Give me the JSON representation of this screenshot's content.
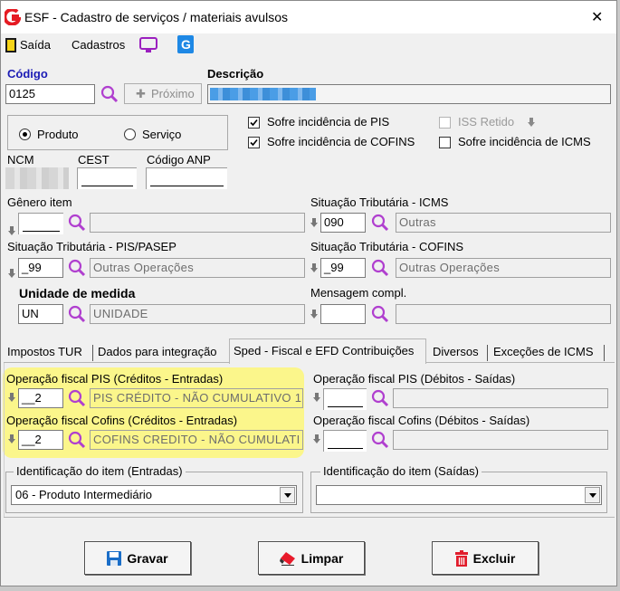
{
  "window": {
    "title": "ESF - Cadastro de serviços / materiais avulsos",
    "close_glyph": "✕"
  },
  "toolbar": {
    "saida": "Saída",
    "cadastros": "Cadastros"
  },
  "codigo": {
    "label": "Código",
    "value": "0125",
    "proximo_label": "Próximo"
  },
  "descricao": {
    "label": "Descrição"
  },
  "tipo": {
    "produto": "Produto",
    "servico": "Serviço",
    "selected": "produto"
  },
  "checks": {
    "pis": {
      "label": "Sofre incidência de PIS",
      "checked": true
    },
    "cofins": {
      "label": "Sofre incidência de COFINS",
      "checked": true
    },
    "iss": {
      "label": "ISS Retido",
      "checked": false
    },
    "icms": {
      "label": "Sofre incidência de ICMS",
      "checked": false
    }
  },
  "ncm": {
    "label": "NCM"
  },
  "cest": {
    "label": "CEST"
  },
  "anp": {
    "label": "Código ANP"
  },
  "genero": {
    "label": "Gênero item"
  },
  "icms_st": {
    "label": "Situação Tributária - ICMS",
    "code": "090",
    "desc": "Outras"
  },
  "pis_st": {
    "label": "Situação Tributária - PIS/PASEP",
    "code": "_99",
    "desc": "Outras Operações"
  },
  "cofins_st": {
    "label": "Situação Tributária - COFINS",
    "code": "_99",
    "desc": "Outras Operações"
  },
  "unidade": {
    "label": "Unidade de medida",
    "code": "UN",
    "desc": "UNIDADE"
  },
  "mensagem": {
    "label": "Mensagem compl."
  },
  "tabs": [
    "Impostos TUR",
    "Dados para integração",
    "Sped - Fiscal e EFD Contribuições",
    "Diversos",
    "Exceções de ICMS"
  ],
  "sped": {
    "pis_entrada": {
      "label": "Operação fiscal PIS (Créditos - Entradas)",
      "code": "__2",
      "desc": "PIS CRÉDITO - NÃO CUMULATIVO 1."
    },
    "cofins_entrada": {
      "label": "Operação fiscal Cofins (Créditos - Entradas)",
      "code": "__2",
      "desc": "COFINS  CREDITO - NÃO CUMULATI"
    },
    "pis_saida": {
      "label": "Operação fiscal PIS (Débitos - Saídas)"
    },
    "cofins_saida": {
      "label": "Operação fiscal Cofins (Débitos - Saídas)"
    },
    "ident_entrada": {
      "label": "Identificação do item (Entradas)",
      "value": "06 - Produto Intermediário"
    },
    "ident_saida": {
      "label": "Identificação do item (Saídas)",
      "value": ""
    }
  },
  "buttons": {
    "gravar": "Gravar",
    "limpar": "Limpar",
    "excluir": "Excluir"
  },
  "colors": {
    "accent": "#1c1cb5",
    "highlight": "#fbf68b",
    "brand_red": "#e51b23",
    "blur_blue": "#4a9de6"
  }
}
